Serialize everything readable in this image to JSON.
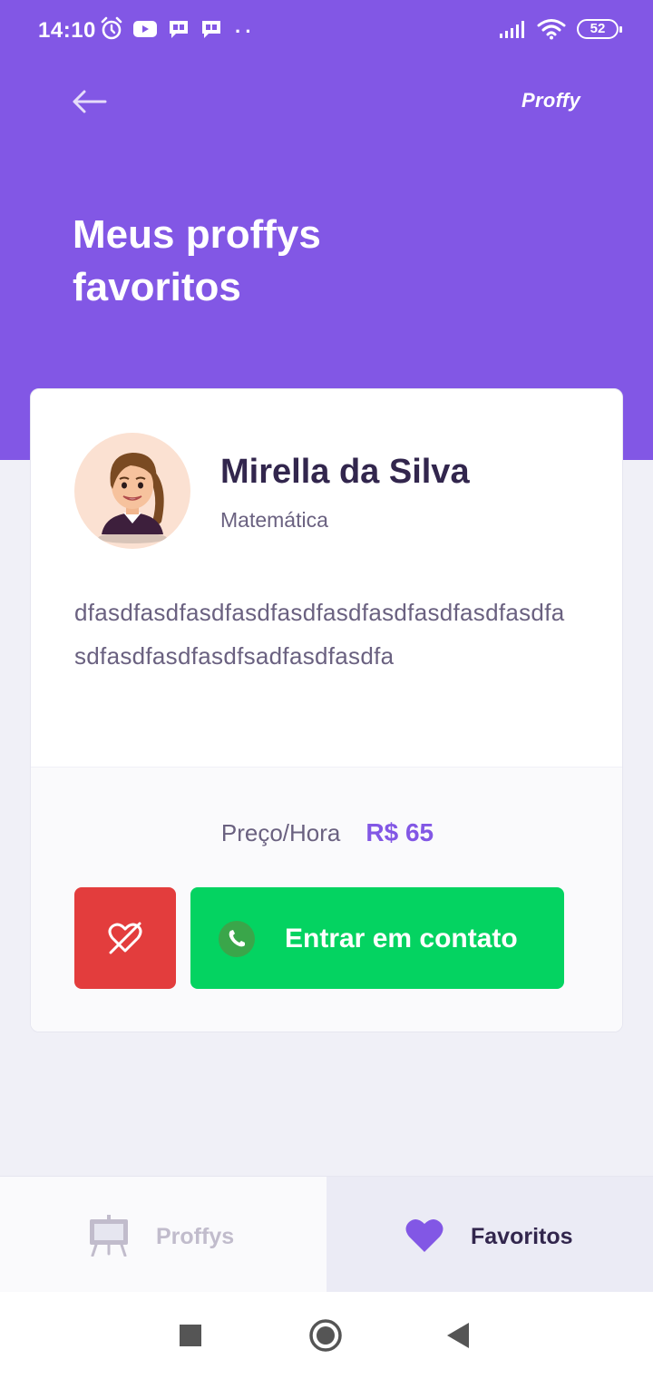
{
  "status_bar": {
    "time": "14:10",
    "dots": "··",
    "battery": "52",
    "icons": [
      "alarm-icon",
      "youtube-icon",
      "chat-icon",
      "chat-icon",
      "signal-icon",
      "wifi-icon",
      "battery-icon"
    ]
  },
  "header": {
    "brand": "Proffy",
    "title": "Meus proffys favoritos",
    "background_color": "#8257e5"
  },
  "card": {
    "teacher_name": "Mirella da Silva",
    "subject": "Matemática",
    "bio": "dfasdfasdfasdfasdfasdfasdfasdfasdfasdfasdfasdfasdfasdfasdfsadfasdfasdfa",
    "price_label": "Preço/Hora",
    "price_value": "R$ 65",
    "contact_button": "Entrar em contato",
    "unfavorite_color": "#e33d3d",
    "contact_color": "#04d361"
  },
  "tabs": [
    {
      "label": "Proffys",
      "icon": "easel-icon",
      "active": false
    },
    {
      "label": "Favoritos",
      "icon": "heart-icon",
      "active": true
    }
  ],
  "nav": {
    "buttons": [
      "recents-square-icon",
      "home-circle-icon",
      "back-triangle-icon"
    ]
  }
}
